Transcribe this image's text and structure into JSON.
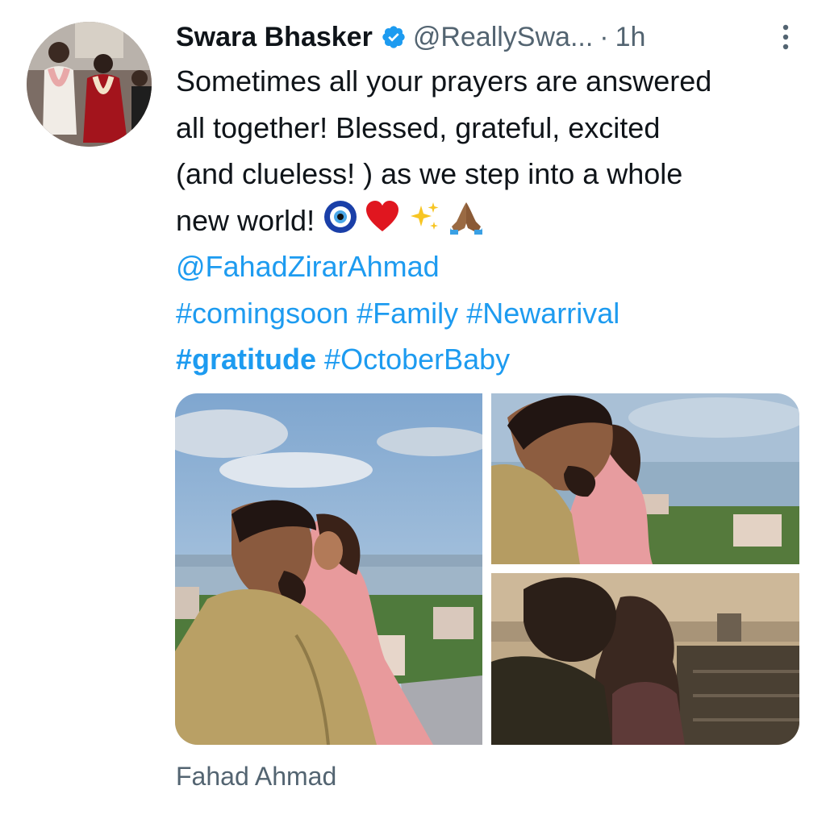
{
  "tweet": {
    "author_name": "Swara Bhasker",
    "author_handle": "@ReallySwa...",
    "separator": "·",
    "time": "1h",
    "text_lines": [
      "Sometimes all your prayers are answered",
      "all together! Blessed, grateful, excited",
      "(and clueless! ) as we step into a whole",
      "new world!"
    ],
    "emojis": [
      "nazar-amulet-icon",
      "red-heart-icon",
      "sparkles-icon",
      "folded-hands-icon"
    ],
    "mention": "@FahadZirarAhmad",
    "hashtags_line1": [
      "#comingsoon",
      "#Family",
      "#Newarrival"
    ],
    "hashtags_line2": [
      "#gratitude",
      "#OctoberBaby"
    ],
    "tagged_user": "Fahad Ahmad"
  },
  "colors": {
    "link": "#1d9bf0",
    "verified": "#1d9bf0",
    "secondary_text": "#536471",
    "primary_text": "#0f1419"
  }
}
